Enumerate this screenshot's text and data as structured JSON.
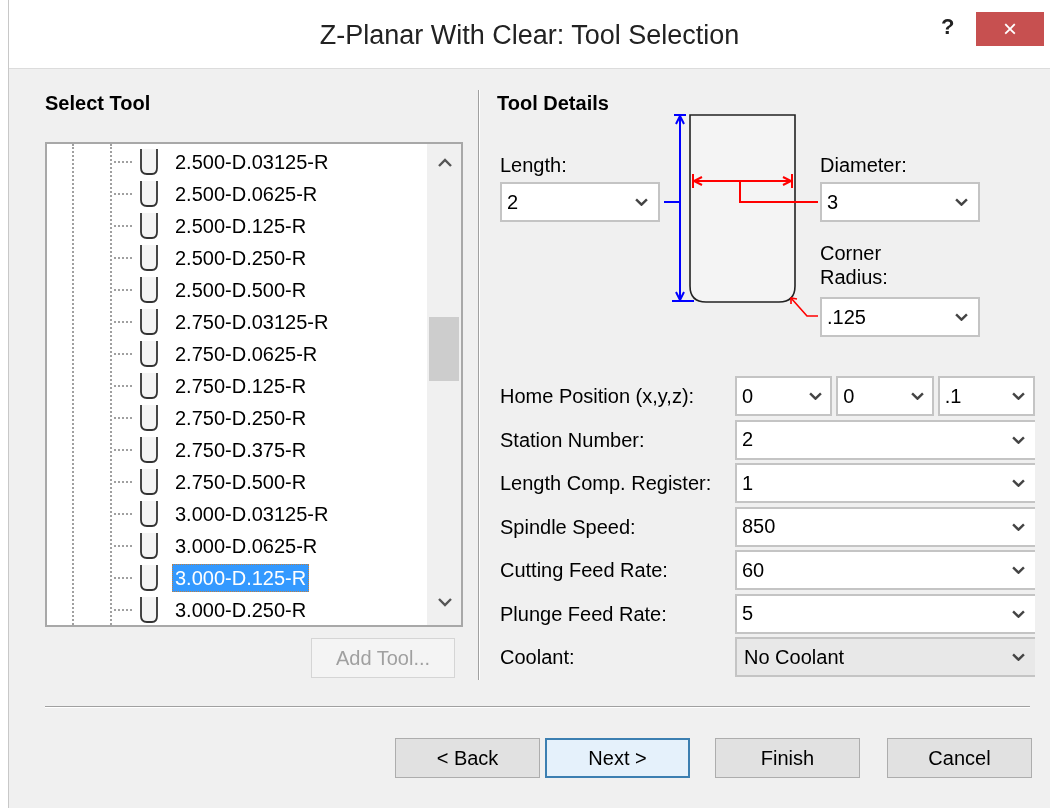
{
  "window": {
    "title": "Z-Planar With Clear: Tool Selection",
    "help": "?",
    "close": "×"
  },
  "select_tool": {
    "heading": "Select Tool",
    "items": [
      {
        "label": "2.500-D.03125-R",
        "selected": false
      },
      {
        "label": "2.500-D.0625-R",
        "selected": false
      },
      {
        "label": "2.500-D.125-R",
        "selected": false
      },
      {
        "label": "2.500-D.250-R",
        "selected": false
      },
      {
        "label": "2.500-D.500-R",
        "selected": false
      },
      {
        "label": "2.750-D.03125-R",
        "selected": false
      },
      {
        "label": "2.750-D.0625-R",
        "selected": false
      },
      {
        "label": "2.750-D.125-R",
        "selected": false
      },
      {
        "label": "2.750-D.250-R",
        "selected": false
      },
      {
        "label": "2.750-D.375-R",
        "selected": false
      },
      {
        "label": "2.750-D.500-R",
        "selected": false
      },
      {
        "label": "3.000-D.03125-R",
        "selected": false
      },
      {
        "label": "3.000-D.0625-R",
        "selected": false
      },
      {
        "label": "3.000-D.125-R",
        "selected": true
      },
      {
        "label": "3.000-D.250-R",
        "selected": false
      }
    ],
    "add_button": {
      "label": "Add Tool...",
      "disabled": true
    }
  },
  "tool_details": {
    "heading": "Tool Details",
    "length": {
      "label": "Length:",
      "value": "2"
    },
    "diameter": {
      "label": "Diameter:",
      "value": "3"
    },
    "corner_radius": {
      "label": "Corner Radius:",
      "value": ".125"
    },
    "fields": [
      {
        "label": "Home Position (x,y,z):",
        "kind": "combo",
        "values": [
          "0",
          "0",
          ".1"
        ]
      },
      {
        "label": "Station Number:",
        "kind": "combo",
        "values": [
          "2"
        ]
      },
      {
        "label": "Length Comp. Register:",
        "kind": "combo",
        "values": [
          "1"
        ]
      },
      {
        "label": "Spindle Speed:",
        "kind": "combo",
        "values": [
          "850"
        ]
      },
      {
        "label": "Cutting Feed Rate:",
        "kind": "combo",
        "values": [
          "60"
        ]
      },
      {
        "label": "Plunge Feed Rate:",
        "kind": "combo",
        "values": [
          "5"
        ]
      },
      {
        "label": "Coolant:",
        "kind": "list",
        "values": [
          "No Coolant"
        ]
      }
    ]
  },
  "buttons": [
    {
      "label": "< Back",
      "default": false
    },
    {
      "label": "Next >",
      "default": true
    },
    {
      "label": "Finish",
      "default": false
    },
    {
      "label": "Cancel",
      "default": false
    }
  ]
}
